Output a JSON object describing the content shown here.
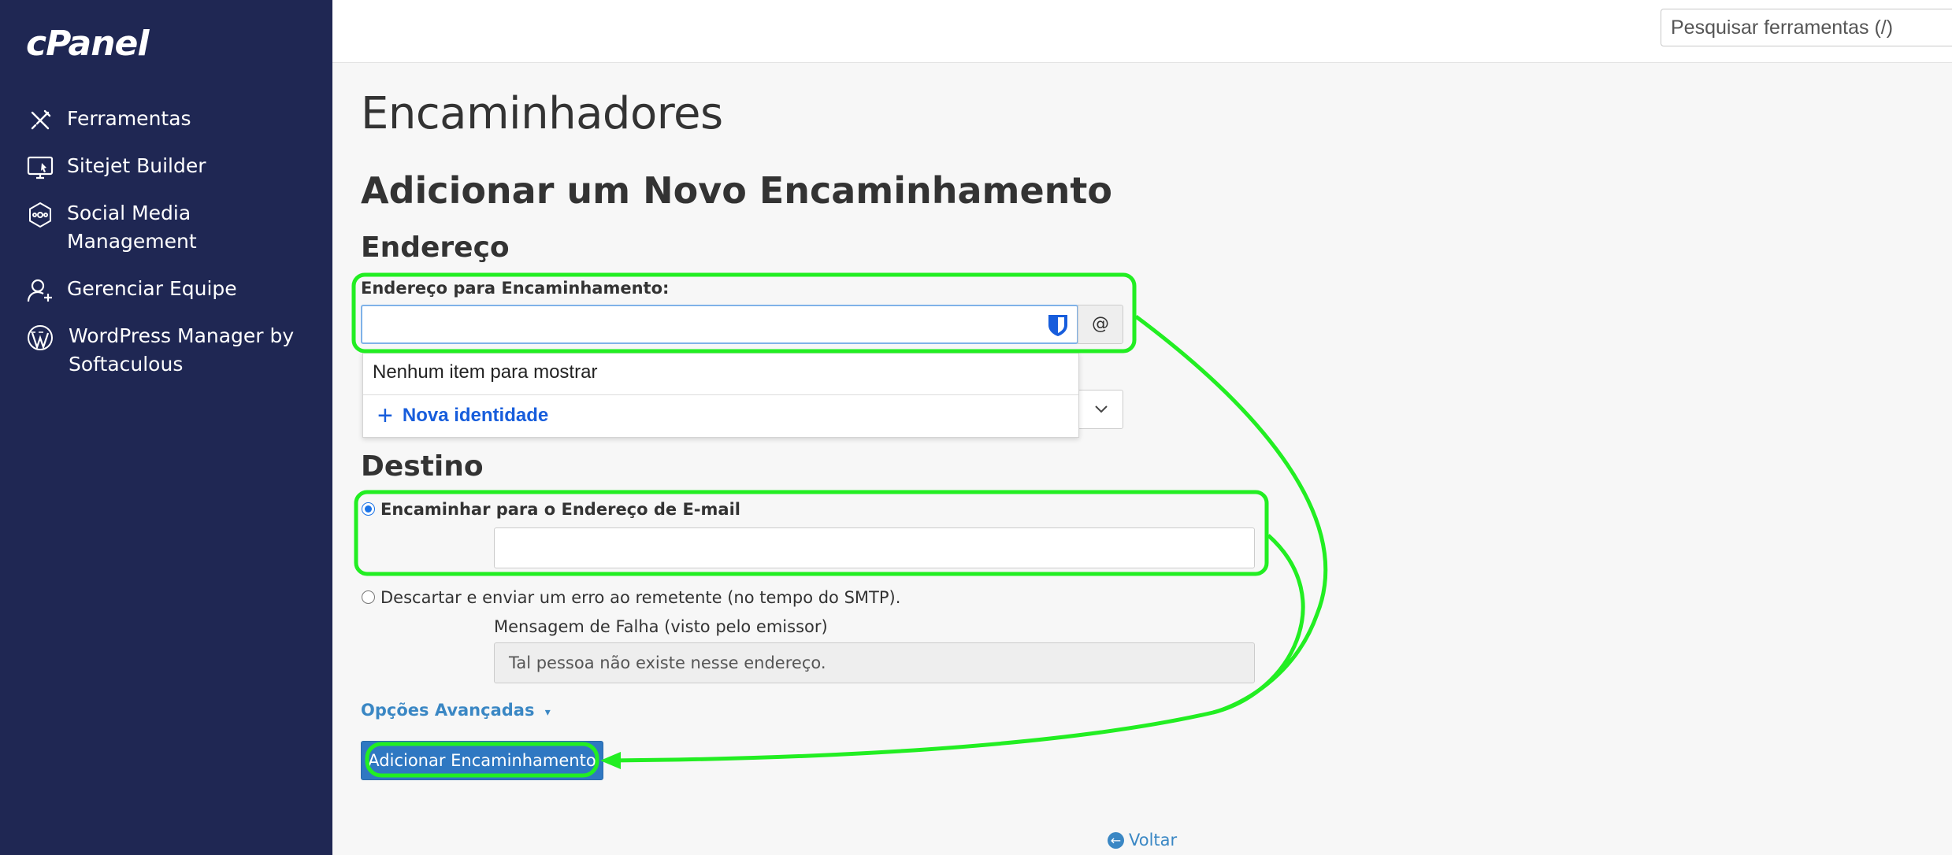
{
  "app": {
    "logo": "cPanel"
  },
  "sidebar": {
    "items": [
      {
        "label": "Ferramentas",
        "icon": "tools-icon"
      },
      {
        "label": "Sitejet Builder",
        "icon": "monitor-icon"
      },
      {
        "label": "Social Media Management",
        "icon": "social-hub-icon"
      },
      {
        "label": "Gerenciar Equipe",
        "icon": "user-add-icon"
      },
      {
        "label": "WordPress Manager by Softaculous",
        "icon": "wordpress-icon"
      }
    ]
  },
  "search": {
    "placeholder": "Pesquisar ferramentas (/)"
  },
  "page": {
    "title": "Encaminhadores",
    "section_title": "Adicionar um Novo Encaminhamento",
    "address_heading": "Endereço",
    "address_label": "Endereço para Encaminhamento:",
    "address_value": "",
    "at_sign": "@",
    "dropdown": {
      "empty_text": "Nenhum item para mostrar",
      "new_identity": "Nova identidade"
    },
    "destination_heading": "Destino",
    "forward_option_label": "Encaminhar para o Endereço de E-mail",
    "forward_value": "",
    "discard_option_label": "Descartar e enviar um erro ao remetente (no tempo do SMTP).",
    "failure_message_label": "Mensagem de Falha (visto pelo emissor)",
    "failure_message_value": "Tal pessoa não existe nesse endereço.",
    "advanced_options": "Opções Avançadas",
    "submit_button": "Adicionar Encaminhamento",
    "back_link": "Voltar"
  },
  "colors": {
    "sidebar_bg": "#1f2753",
    "accent": "#2f78c2",
    "annotation": "#22ee22"
  }
}
